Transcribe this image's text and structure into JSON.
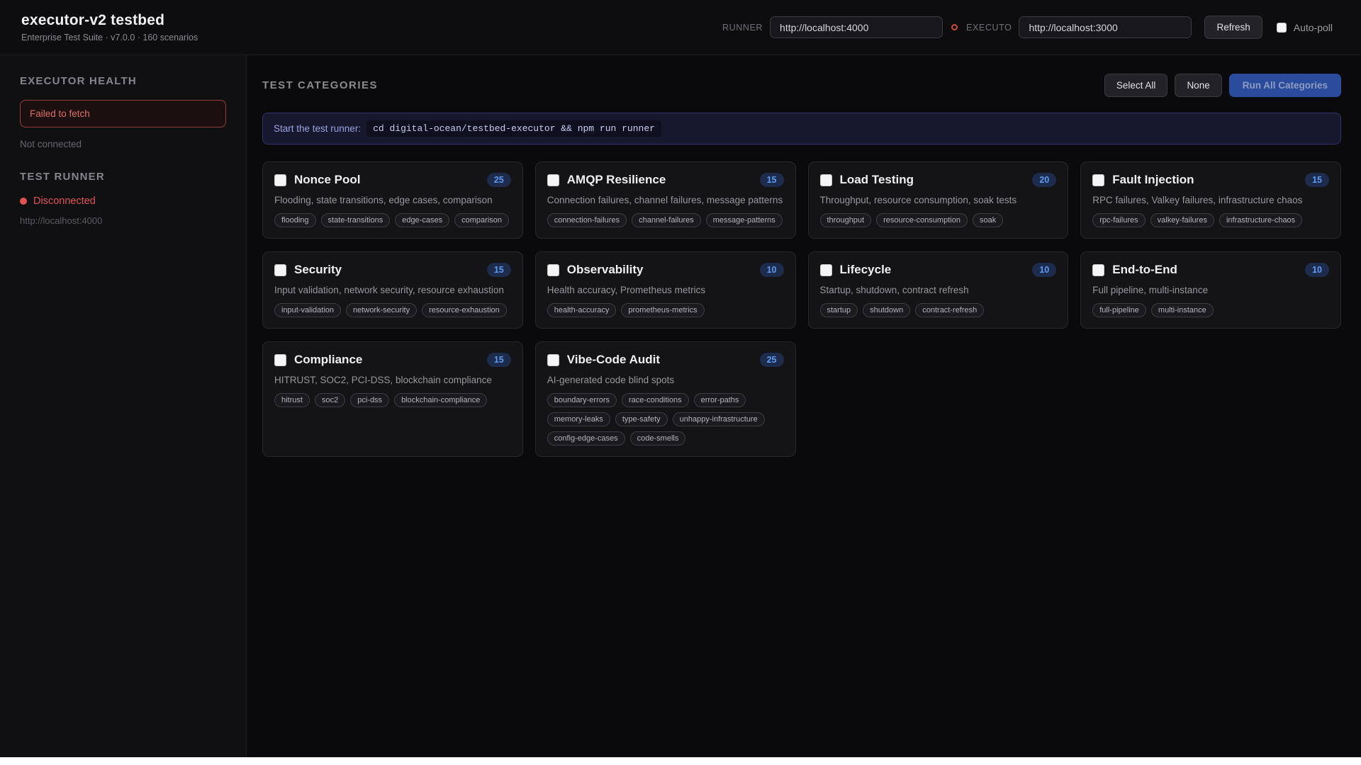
{
  "header": {
    "title": "executor-v2 testbed",
    "subtitle": "Enterprise Test Suite · v7.0.0 · 160 scenarios",
    "runner_label": "RUNNER",
    "runner_url": "http://localhost:4000",
    "executor_label": "EXECUTO",
    "executor_url": "http://localhost:3000",
    "refresh_label": "Refresh",
    "autopoll_label": "Auto-poll"
  },
  "sidebar": {
    "executor_health": {
      "heading": "EXECUTOR HEALTH",
      "error": "Failed to fetch",
      "status": "Not connected"
    },
    "test_runner": {
      "heading": "TEST RUNNER",
      "status": "Disconnected",
      "url": "http://localhost:4000"
    }
  },
  "main": {
    "heading": "TEST CATEGORIES",
    "select_all_label": "Select All",
    "none_label": "None",
    "run_all_label": "Run All Categories",
    "banner": {
      "text": "Start the test runner:",
      "command": "cd digital-ocean/testbed-executor && npm run runner"
    },
    "categories": [
      {
        "name": "Nonce Pool",
        "count": "25",
        "description": "Flooding, state transitions, edge cases, comparison",
        "tags": [
          "flooding",
          "state-transitions",
          "edge-cases",
          "comparison"
        ]
      },
      {
        "name": "AMQP Resilience",
        "count": "15",
        "description": "Connection failures, channel failures, message patterns",
        "tags": [
          "connection-failures",
          "channel-failures",
          "message-patterns"
        ]
      },
      {
        "name": "Load Testing",
        "count": "20",
        "description": "Throughput, resource consumption, soak tests",
        "tags": [
          "throughput",
          "resource-consumption",
          "soak"
        ]
      },
      {
        "name": "Fault Injection",
        "count": "15",
        "description": "RPC failures, Valkey failures, infrastructure chaos",
        "tags": [
          "rpc-failures",
          "valkey-failures",
          "infrastructure-chaos"
        ]
      },
      {
        "name": "Security",
        "count": "15",
        "description": "Input validation, network security, resource exhaustion",
        "tags": [
          "input-validation",
          "network-security",
          "resource-exhaustion"
        ]
      },
      {
        "name": "Observability",
        "count": "10",
        "description": "Health accuracy, Prometheus metrics",
        "tags": [
          "health-accuracy",
          "prometheus-metrics"
        ]
      },
      {
        "name": "Lifecycle",
        "count": "10",
        "description": "Startup, shutdown, contract refresh",
        "tags": [
          "startup",
          "shutdown",
          "contract-refresh"
        ]
      },
      {
        "name": "End-to-End",
        "count": "10",
        "description": "Full pipeline, multi-instance",
        "tags": [
          "full-pipeline",
          "multi-instance"
        ]
      },
      {
        "name": "Compliance",
        "count": "15",
        "description": "HITRUST, SOC2, PCI-DSS, blockchain compliance",
        "tags": [
          "hitrust",
          "soc2",
          "pci-dss",
          "blockchain-compliance"
        ]
      },
      {
        "name": "Vibe-Code Audit",
        "count": "25",
        "description": "AI-generated code blind spots",
        "tags": [
          "boundary-errors",
          "race-conditions",
          "error-paths",
          "memory-leaks",
          "type-safety",
          "unhappy-infrastructure",
          "config-edge-cases",
          "code-smells"
        ]
      }
    ]
  },
  "colors": {
    "run_all_button_bg": "#2b4c9c",
    "badge_bg": "#1d2b4d",
    "badge_text": "#5f9bef",
    "error_red": "#e05252",
    "banner_border": "#33336a"
  }
}
